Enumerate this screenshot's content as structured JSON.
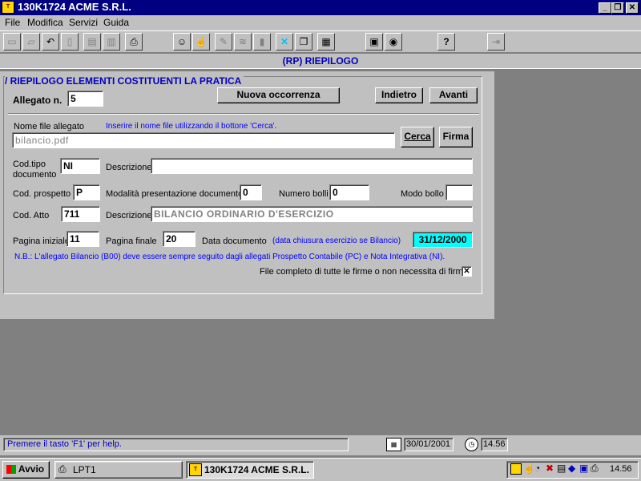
{
  "window": {
    "title": "130K1724 ACME S.R.L."
  },
  "menu": [
    "File",
    "Modifica",
    "Servizi",
    "Guida"
  ],
  "section_header": "(RP)  RIEPILOGO",
  "panel": {
    "title": "/ RIEPILOGO ELEMENTI COSTITUENTI LA PRATICA",
    "allegato_label": "Allegato n.",
    "allegato_value": "5",
    "nuova_occorrenza": "Nuova occorrenza",
    "indietro": "Indietro",
    "avanti": "Avanti",
    "nome_file_label": "Nome file allegato",
    "nome_file_hint": "Inserire il nome file utilizzando il bottone 'Cerca'.",
    "nome_file_value": "bilancio.pdf",
    "cerca": "Cerca",
    "firma": "Firma",
    "cod_tipo_label_1": "Cod.tipo",
    "cod_tipo_label_2": "documento",
    "cod_tipo_value": "NI",
    "descrizione_label": "Descrizione",
    "descrizione_value": "",
    "cod_prospetto_label": "Cod. prospetto",
    "cod_prospetto_value": "P",
    "modalita_label": "Modalità presentazione documento",
    "modalita_value": "0",
    "numero_bolli_label": "Numero bolli",
    "numero_bolli_value": "0",
    "modo_bollo_label": "Modo bollo",
    "modo_bollo_value": "",
    "cod_atto_label": "Cod. Atto",
    "cod_atto_value": "711",
    "descrizione2_label": "Descrizione",
    "descrizione2_value": "BILANCIO ORDINARIO D'ESERCIZIO",
    "pagina_iniziale_label": "Pagina iniziale",
    "pagina_iniziale_value": "11",
    "pagina_finale_label": "Pagina finale",
    "pagina_finale_value": "20",
    "data_documento_label": "Data documento",
    "data_hint": "(data chiusura esercizio se Bilancio)",
    "data_value": "31/12/2000",
    "note": "N.B.: L'allegato Bilancio (B00) deve essere sempre seguito dagli allegati Prospetto Contabile (PC) e Nota Integrativa (NI).",
    "checkbox_label": "File completo di tutte le firme o non necessita di firme.",
    "checkbox_mark": "✕"
  },
  "status": {
    "help": "Premere il tasto 'F1' per help.",
    "date": "30/01/2001",
    "time": "14.56"
  },
  "taskbar": {
    "start": "Avvio",
    "tasks": [
      "LPT1",
      "130K1724 ACME S.R.L."
    ],
    "clock": "14.56"
  },
  "colors": {
    "title_bar": "#000080",
    "form_title": "#0000c0",
    "hint_blue": "#0000ff",
    "date_bg": "#00ffff"
  }
}
